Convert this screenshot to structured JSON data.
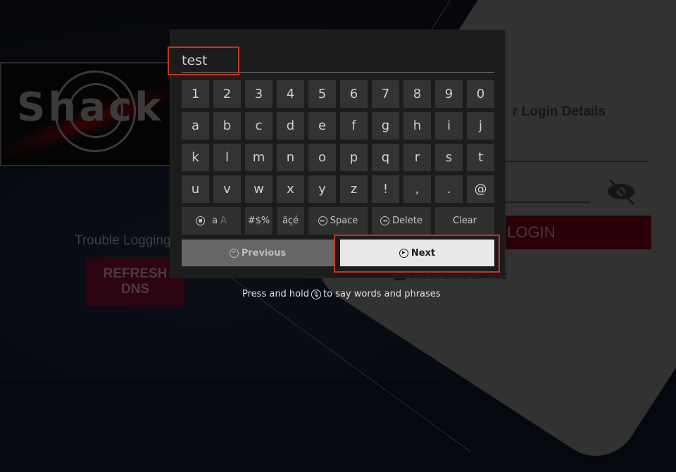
{
  "background_app": {
    "logo_text": "Shack",
    "trouble_text": "Trouble Logging",
    "refresh_dns_label": "REFRESH DNS",
    "login_title": "r Login Details",
    "login_button_label": "LOGIN",
    "remember_label": "Remember me"
  },
  "keyboard": {
    "input_value": "test",
    "rows": [
      [
        "1",
        "2",
        "3",
        "4",
        "5",
        "6",
        "7",
        "8",
        "9",
        "0"
      ],
      [
        "a",
        "b",
        "c",
        "d",
        "e",
        "f",
        "g",
        "h",
        "i",
        "j"
      ],
      [
        "k",
        "l",
        "m",
        "n",
        "o",
        "p",
        "q",
        "r",
        "s",
        "t"
      ],
      [
        "u",
        "v",
        "w",
        "x",
        "y",
        "z",
        "!",
        ",",
        ".",
        "@"
      ]
    ],
    "function_keys": {
      "case_lower": "a",
      "case_upper": "A",
      "symbols": "#$%",
      "accents": "äçé",
      "space": "Space",
      "delete": "Delete",
      "clear": "Clear"
    },
    "previous_label": "Previous",
    "next_label": "Next",
    "hint_before": "Press and hold",
    "hint_after": "to say words and phrases"
  },
  "colors": {
    "highlight": "#c8321e",
    "key_bg": "#333333",
    "next_bg": "#e8e8e8"
  }
}
